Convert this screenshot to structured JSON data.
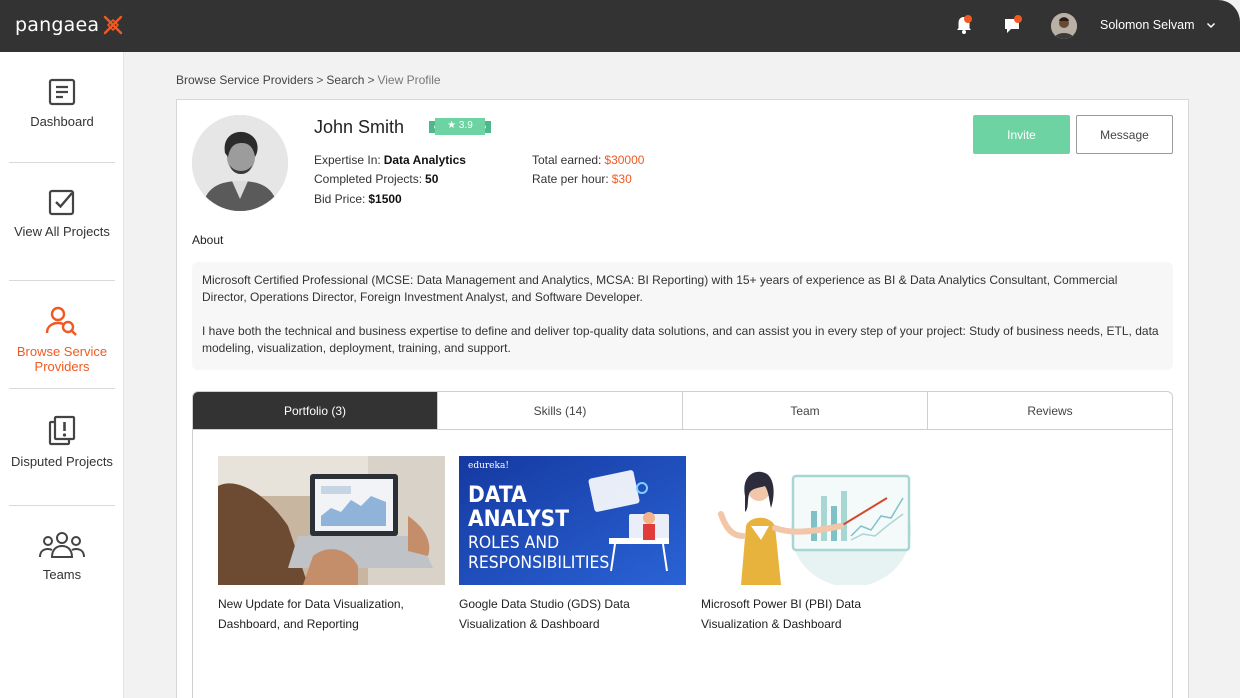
{
  "app": {
    "logo_text": "pangaea"
  },
  "topbar": {
    "user_name": "Solomon Selvam",
    "colors": {
      "background": "#333333",
      "notification_dot": "#f05a22"
    }
  },
  "sidebar": {
    "items": [
      {
        "label": "Dashboard",
        "icon": "dashboard-icon",
        "active": false
      },
      {
        "label": "View All Projects",
        "icon": "checkbox-icon",
        "active": false
      },
      {
        "label": "Browse Service Providers",
        "icon": "user-search-icon",
        "active": true
      },
      {
        "label": "Disputed Projects",
        "icon": "dispute-icon",
        "active": false
      },
      {
        "label": "Teams",
        "icon": "team-icon",
        "active": false
      }
    ],
    "accent": "#f05a22"
  },
  "breadcrumb": {
    "items": [
      "Browse Service Providers",
      "Search",
      "View Profile"
    ],
    "separator": ">"
  },
  "profile": {
    "name": "John Smith",
    "rating": "3.9",
    "expertise_label": "Expertise In:",
    "expertise_value": "Data Analytics",
    "completed_label": "Completed Projects:",
    "completed_value": "50",
    "bid_label": "Bid Price:",
    "bid_value": "$1500",
    "earned_label": "Total earned:",
    "earned_value": "$30000",
    "rate_label": "Rate per hour:",
    "rate_value": "$30"
  },
  "actions": {
    "invite_label": "Invite",
    "message_label": "Message"
  },
  "about": {
    "title": "About",
    "paragraphs": [
      "Microsoft Certified Professional (MCSE: Data Management and Analytics, MCSA: BI Reporting) with 15+ years of experience as BI & Data Analytics Consultant, Commercial Director, Operations Director, Foreign Investment Analyst, and Software Developer.",
      "I have both the technical and business expertise to define and deliver top-quality data solutions, and can assist you in every step of your project: Study of business needs, ETL, data modeling, visualization, deployment, training, and support."
    ]
  },
  "tabs": [
    {
      "label": "Portfolio (3)",
      "active": true
    },
    {
      "label": "Skills (14)",
      "active": false
    },
    {
      "label": "Team",
      "active": false
    },
    {
      "label": "Reviews",
      "active": false
    }
  ],
  "portfolio": [
    {
      "title": "New Update for Data Visualization, Dashboard, and Reporting"
    },
    {
      "title": "Google Data Studio (GDS) Data Visualization & Dashboard",
      "image_text": {
        "brand": "edureka!",
        "line1": "DATA",
        "line2": "ANALYST",
        "line3": "ROLES AND",
        "line4": "RESPONSIBILITIES"
      }
    },
    {
      "title": "Microsoft Power BI (PBI) Data Visualization & Dashboard"
    }
  ]
}
